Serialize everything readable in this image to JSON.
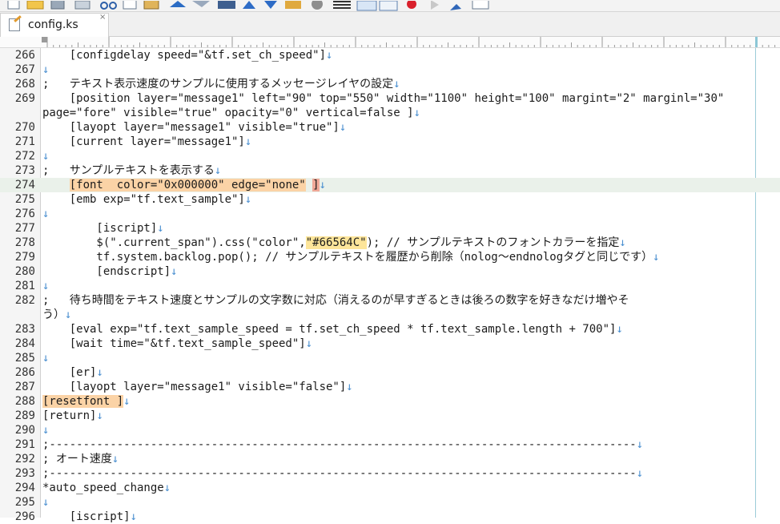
{
  "tab": {
    "title": "config.ks",
    "close": "×"
  },
  "toolbar": {
    "icons": [
      "new-file-icon",
      "open-folder-icon",
      "save-icon",
      "print-icon",
      "cut-icon",
      "copy-icon",
      "paste-icon",
      "undo-icon",
      "redo-icon",
      "find-icon",
      "find-up-icon",
      "find-down-icon",
      "replace-icon",
      "grep-icon",
      "wrap-icon",
      "indent-icon",
      "outdent-icon",
      "record-icon",
      "play-icon",
      "pin-icon",
      "window-icon"
    ]
  },
  "line_end_mark": "↓",
  "lines": [
    {
      "num": "266",
      "text": "    [configdelay speed=\"&tf.set_ch_speed\"]"
    },
    {
      "num": "267",
      "text": ""
    },
    {
      "num": "268",
      "text": ";   テキスト表示速度のサンプルに使用するメッセージレイヤの設定"
    },
    {
      "num": "269",
      "text": "    [position layer=\"message1\" left=\"90\" top=\"550\" width=\"1100\" height=\"100\" margint=\"2\" marginl=\"30\"",
      "nomark": true
    },
    {
      "num": "",
      "text": "page=\"fore\" visible=\"true\" opacity=\"0\" vertical=false ]"
    },
    {
      "num": "270",
      "text": "    [layopt layer=\"message1\" visible=\"true\"]"
    },
    {
      "num": "271",
      "text": "    [current layer=\"message1\"]"
    },
    {
      "num": "272",
      "text": ""
    },
    {
      "num": "273",
      "text": ";   サンプルテキストを表示する"
    },
    {
      "num": "274",
      "text": "    [font  color=\"0x000000\" edge=\"none\" ]",
      "current": true
    },
    {
      "num": "275",
      "text": "    [emb exp=\"tf.text_sample\"]"
    },
    {
      "num": "276",
      "text": ""
    },
    {
      "num": "277",
      "text": "        [iscript]"
    },
    {
      "num": "278",
      "text": "        $(\".current_span\").css(\"color\",\"#66564C\"); // サンプルテキストのフォントカラーを指定"
    },
    {
      "num": "279",
      "text": "        tf.system.backlog.pop(); // サンプルテキストを履歴から削除（nolog〜endnologタグと同じです）"
    },
    {
      "num": "280",
      "text": "        [endscript]"
    },
    {
      "num": "281",
      "text": ""
    },
    {
      "num": "282",
      "text": ";   待ち時間をテキスト速度とサンプルの文字数に対応（消えるのが早すぎるときは後ろの数字を好きなだけ増やそ",
      "nomark": true
    },
    {
      "num": "",
      "text": "う）"
    },
    {
      "num": "283",
      "text": "    [eval exp=\"tf.text_sample_speed = tf.set_ch_speed * tf.text_sample.length + 700\"]"
    },
    {
      "num": "284",
      "text": "    [wait time=\"&tf.text_sample_speed\"]"
    },
    {
      "num": "285",
      "text": ""
    },
    {
      "num": "286",
      "text": "    [er]"
    },
    {
      "num": "287",
      "text": "    [layopt layer=\"message1\" visible=\"false\"]"
    },
    {
      "num": "288",
      "text": "[resetfont ]"
    },
    {
      "num": "289",
      "text": "[return]"
    },
    {
      "num": "290",
      "text": ""
    },
    {
      "num": "291",
      "text": ";---------------------------------------------------------------------------------------"
    },
    {
      "num": "292",
      "text": "; オート速度"
    },
    {
      "num": "293",
      "text": ";---------------------------------------------------------------------------------------"
    },
    {
      "num": "294",
      "text": "*auto_speed_change"
    },
    {
      "num": "295",
      "text": ""
    },
    {
      "num": "296",
      "text": "    [iscript]"
    }
  ]
}
